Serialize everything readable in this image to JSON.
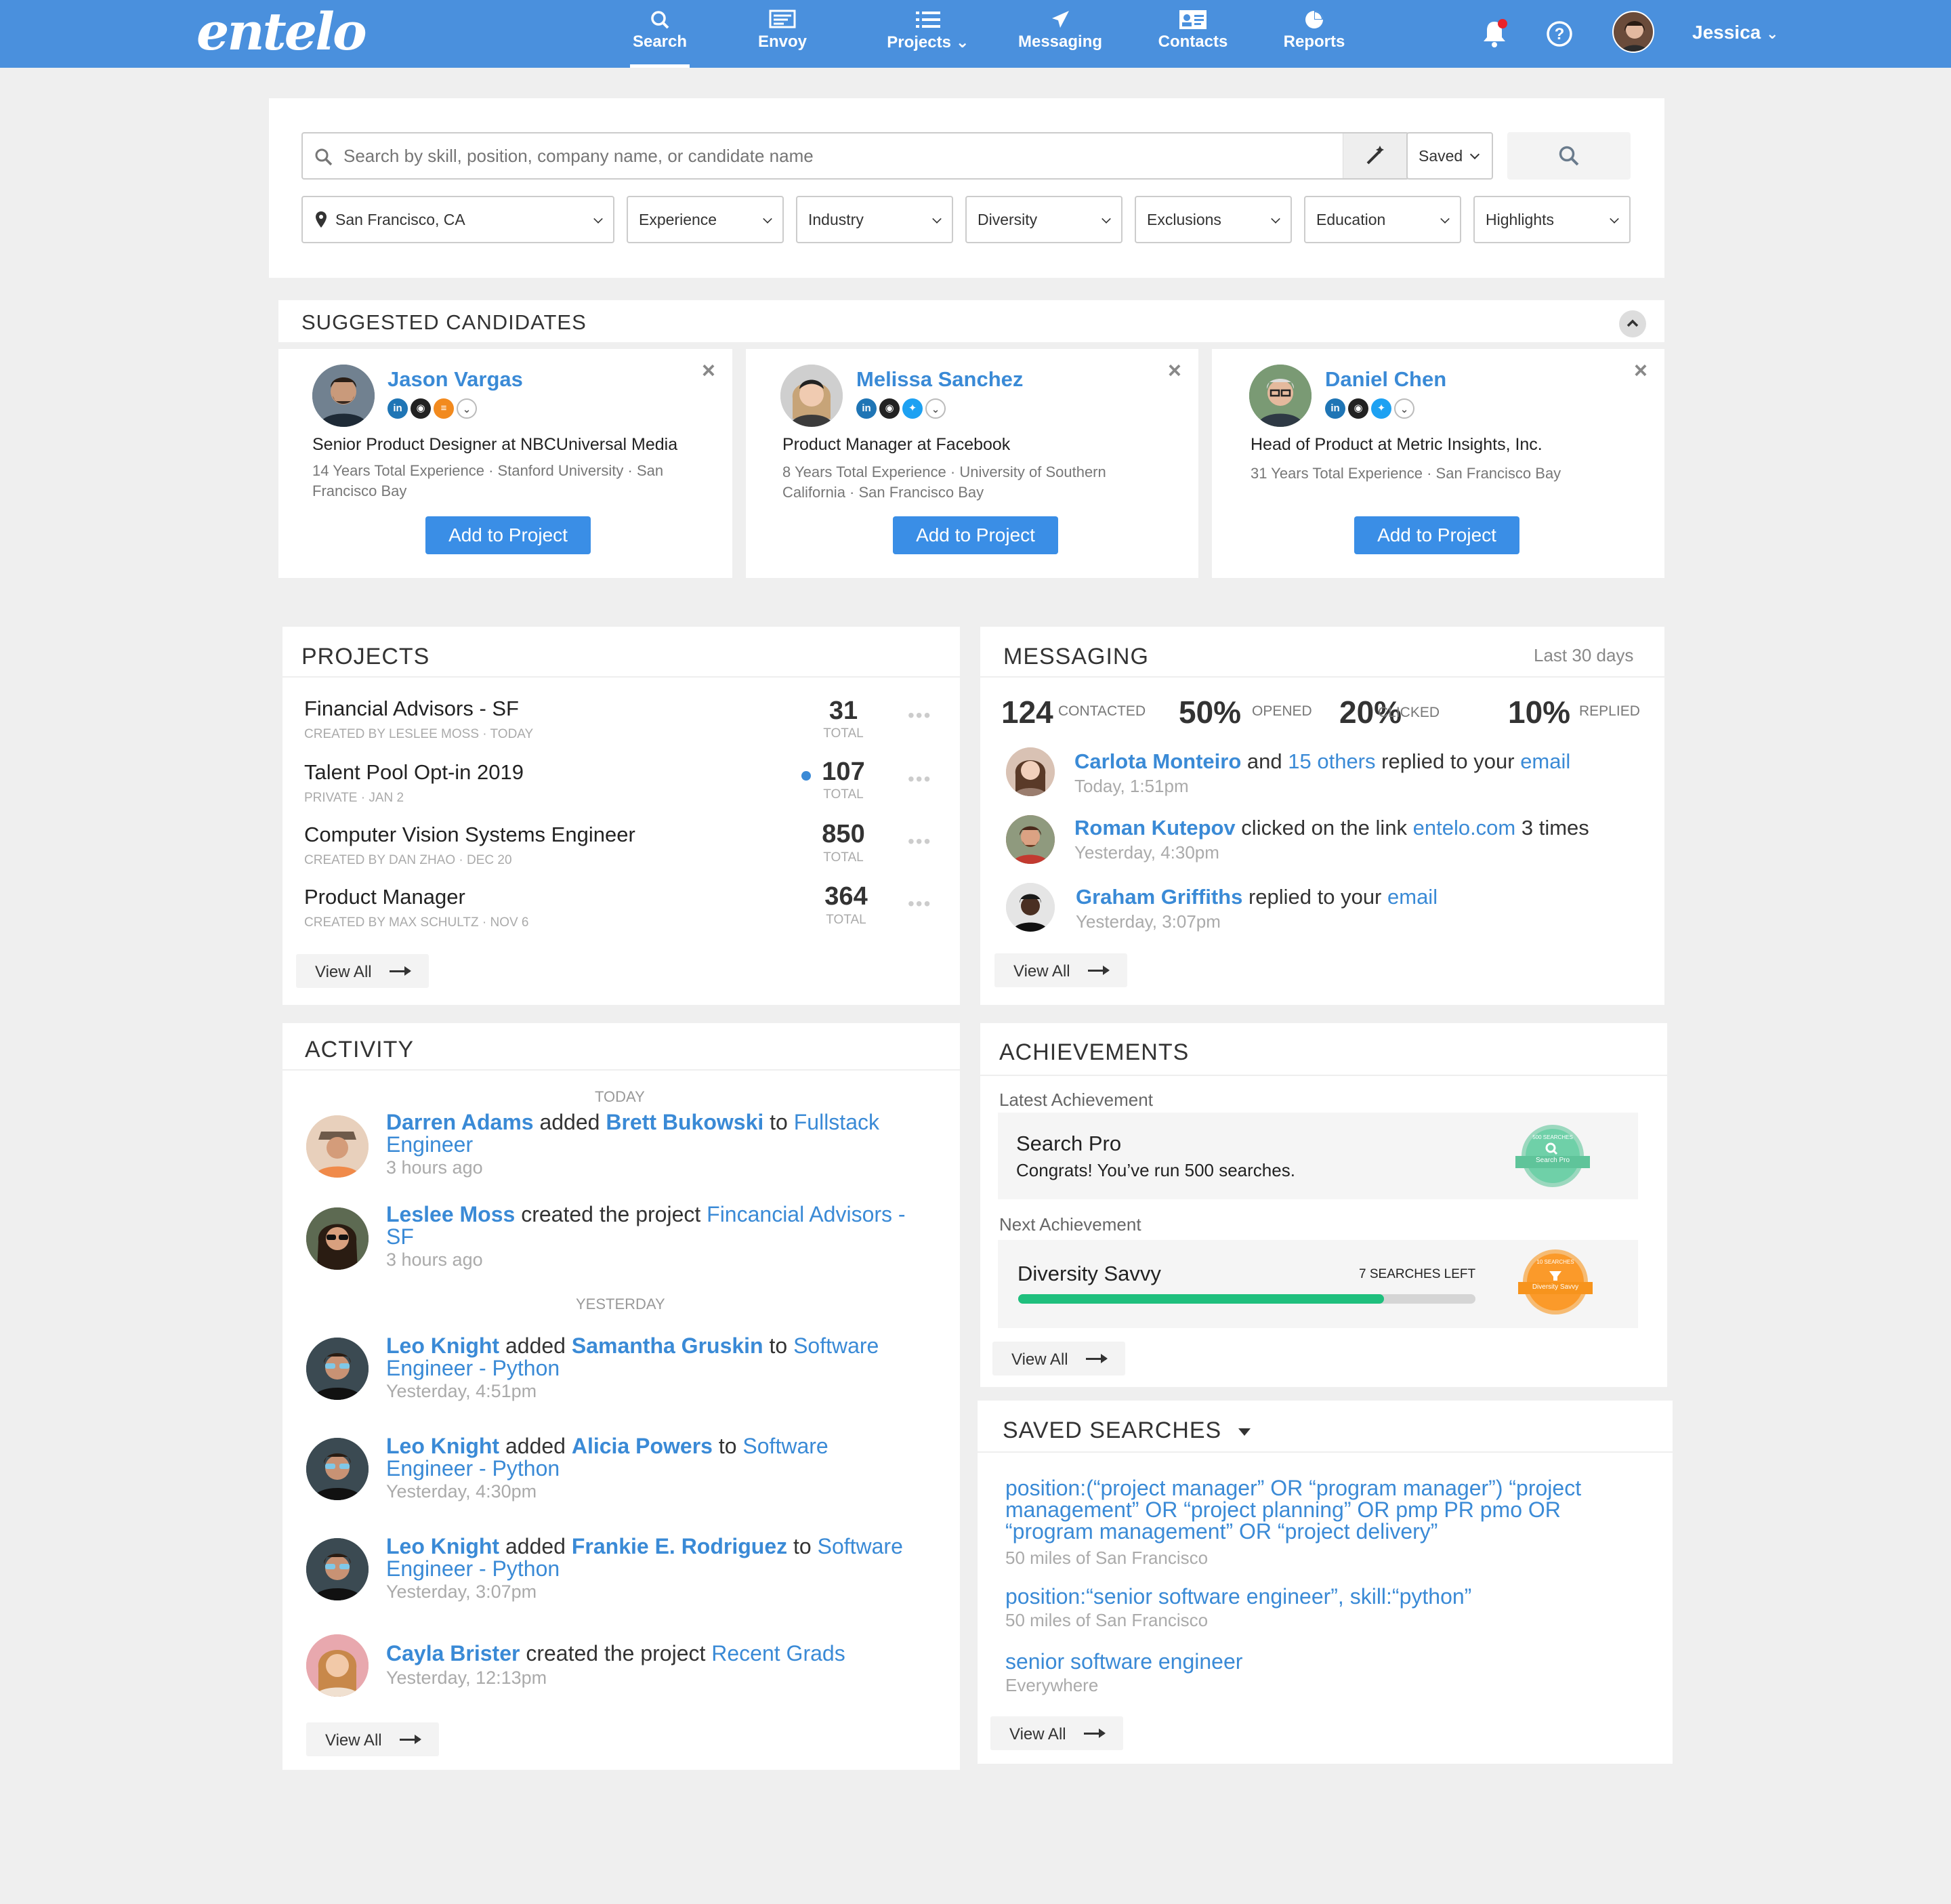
{
  "nav": {
    "logo": "entelo",
    "items": [
      {
        "label": "Search"
      },
      {
        "label": "Envoy"
      },
      {
        "label": "Projects"
      },
      {
        "label": "Messaging"
      },
      {
        "label": "Contacts"
      },
      {
        "label": "Reports"
      }
    ],
    "user": "Jessica"
  },
  "search": {
    "placeholder": "Search by skill, position, company name, or candidate name",
    "saved_label": "Saved",
    "filters": {
      "location": "San Francisco, CA",
      "experience": "Experience",
      "industry": "Industry",
      "diversity": "Diversity",
      "exclusions": "Exclusions",
      "education": "Education",
      "highlights": "Highlights"
    }
  },
  "suggested": {
    "title": "SUGGESTED CANDIDATES",
    "add_label": "Add to Project",
    "candidates": [
      {
        "name": "Jason Vargas",
        "title": "Senior Product Designer at NBCUniversal Media",
        "meta1": "14 Years Total Experience ·  Stanford University ·  San",
        "meta2": "Francisco Bay"
      },
      {
        "name": "Melissa Sanchez",
        "title": "Product Manager at Facebook",
        "meta1": "8 Years Total Experience · University of Southern",
        "meta2": "California ·  San Francisco Bay"
      },
      {
        "name": "Daniel Chen",
        "title": "Head of Product at Metric Insights, Inc.",
        "meta1": "31 Years Total Experience ·  San Francisco Bay",
        "meta2": ""
      }
    ]
  },
  "projects": {
    "title": "PROJECTS",
    "total_label": "TOTAL",
    "view_all": "View All",
    "items": [
      {
        "name": "Financial Advisors - SF",
        "meta": "CREATED BY LESLEE MOSS · TODAY",
        "count": "31"
      },
      {
        "name": "Talent Pool Opt-in 2019",
        "meta": "PRIVATE ·  JAN 2",
        "count": "107"
      },
      {
        "name": "Computer Vision Systems Engineer",
        "meta": "CREATED BY DAN ZHAO ·  DEC 20",
        "count": "850"
      },
      {
        "name": "Product Manager",
        "meta": "CREATED BY MAX SCHULTZ ·  NOV 6",
        "count": "364"
      }
    ]
  },
  "messaging": {
    "title": "MESSAGING",
    "range": "Last 30 days",
    "view_all": "View All",
    "stats": [
      {
        "value": "124",
        "label": "CONTACTED"
      },
      {
        "value": "50%",
        "label": "OPENED"
      },
      {
        "value": "20%",
        "label": "CLICKED"
      },
      {
        "value": "10%",
        "label": "REPLIED"
      }
    ],
    "events": [
      {
        "name": "Carlota Monteiro",
        "t1": " and ",
        "link1": "15 others",
        "t2": " replied to your ",
        "link2": "email",
        "t3": "",
        "time": "Today, 1:51pm"
      },
      {
        "name": "Roman Kutepov",
        "t1": " clicked on the link ",
        "link1": "entelo.com",
        "t2": " 3 times",
        "link2": "",
        "t3": "",
        "time": "Yesterday, 4:30pm"
      },
      {
        "name": "Graham Griffiths",
        "t1": " replied to your ",
        "link1": "email",
        "t2": "",
        "link2": "",
        "t3": "",
        "time": "Yesterday, 3:07pm"
      }
    ]
  },
  "activity": {
    "title": "ACTIVITY",
    "today": "TODAY",
    "yesterday": "YESTERDAY",
    "view_all": "View All",
    "items": [
      {
        "actor": "Darren Adams",
        "verb": " added ",
        "target": "Brett Bukowski",
        "prep": " to ",
        "proj1": "Fullstack",
        "proj2": "Engineer",
        "time": "3 hours ago"
      },
      {
        "actor": "Leslee Moss",
        "verb": " created the project ",
        "target": "",
        "prep": "",
        "proj1": "Fincancial Advisors -",
        "proj2": "SF",
        "time": "3 hours ago"
      },
      {
        "actor": "Leo Knight",
        "verb": " added ",
        "target": "Samantha Gruskin",
        "prep": " to ",
        "proj1": "Software",
        "proj2": "Engineer - Python",
        "time": "Yesterday, 4:51pm"
      },
      {
        "actor": "Leo Knight",
        "verb": " added ",
        "target": "Alicia Powers",
        "prep": " to ",
        "proj1": "Software",
        "proj2": "Engineer - Python",
        "time": "Yesterday, 4:30pm"
      },
      {
        "actor": "Leo Knight",
        "verb": " added ",
        "target": "Frankie E. Rodriguez",
        "prep": " to ",
        "proj1": "Software",
        "proj2": "Engineer - Python",
        "time": "Yesterday, 3:07pm"
      },
      {
        "actor": "Cayla Brister",
        "verb": " created the project ",
        "target": "",
        "prep": "",
        "proj1": "Recent Grads",
        "proj2": "",
        "time": "Yesterday, 12:13pm"
      }
    ]
  },
  "achievements": {
    "title": "ACHIEVEMENTS",
    "latest_label": "Latest Achievement",
    "latest_name": "Search Pro",
    "latest_desc": "Congrats! You’ve run 500 searches.",
    "latest_badge_top": "500 SEARCHES",
    "latest_badge": "Search Pro",
    "next_label": "Next Achievement",
    "next_name": "Diversity Savvy",
    "next_left": "7 SEARCHES LEFT",
    "next_progress": 0.8,
    "next_badge_top": "10 SEARCHES",
    "next_badge": "Diversity Savvy",
    "view_all": "View All"
  },
  "saved_searches": {
    "title": "SAVED SEARCHES",
    "view_all": "View All",
    "items": [
      {
        "l1": "position:(“project manager” OR “program manager”) “project",
        "l2": "management” OR “project planning” OR pmp PR pmo OR",
        "l3": "“program management” OR “project delivery”",
        "where": "50 miles of San Francisco"
      },
      {
        "l1": "position:“senior software engineer”, skill:“python”",
        "l2": "",
        "l3": "",
        "where": "50 miles of San Francisco"
      },
      {
        "l1": "senior software engineer",
        "l2": "",
        "l3": "",
        "where": "Everywhere"
      }
    ]
  },
  "colors": {
    "nav": "#4a90dd",
    "link": "#3a8ad6",
    "button": "#3a8ee6",
    "progress": "#1fbf7d",
    "badge_green": "#5fc49a",
    "badge_orange": "#f7941d",
    "notify": "#e8232a"
  }
}
